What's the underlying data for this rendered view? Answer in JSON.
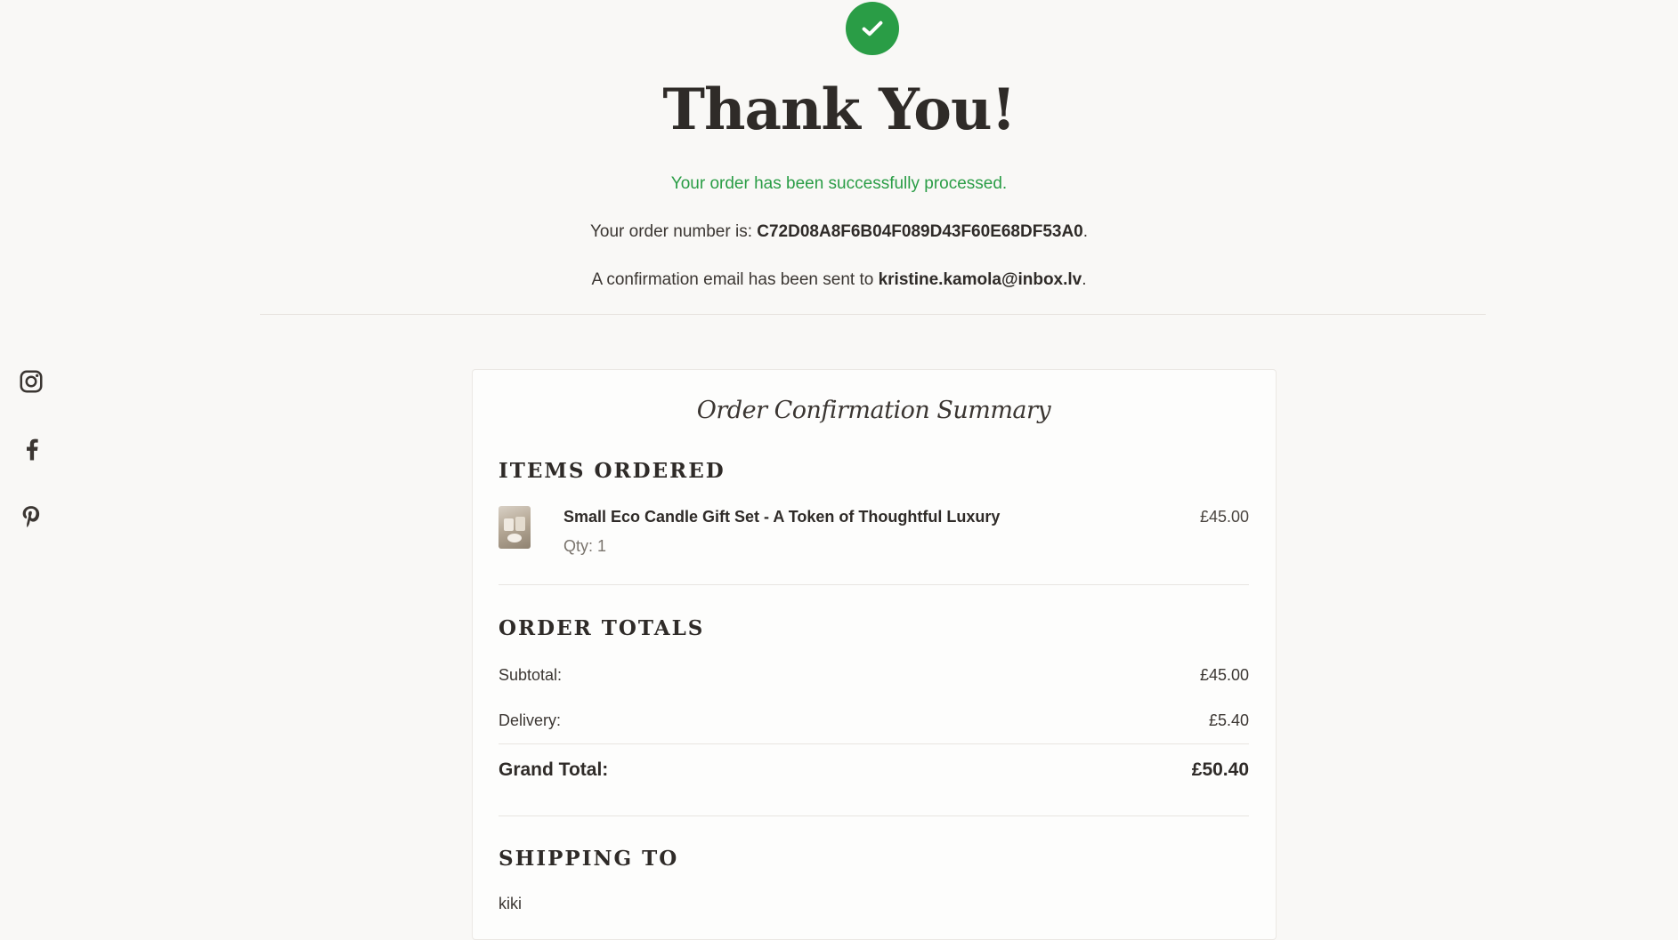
{
  "hero": {
    "title": "Thank You!",
    "success_message": "Your order has been successfully processed.",
    "order_number_prefix": "Your order number is: ",
    "order_number": "C72D08A8F6B04F089D43F60E68DF53A0",
    "order_number_suffix": ".",
    "email_prefix": "A confirmation email has been sent to ",
    "email": "kristine.kamola@inbox.lv",
    "email_suffix": "."
  },
  "social": {
    "icons": [
      "instagram-icon",
      "facebook-icon",
      "pinterest-icon"
    ]
  },
  "summary": {
    "title": "Order Confirmation Summary",
    "items_heading": "Items Ordered",
    "items": [
      {
        "name": "Small Eco Candle Gift Set - A Token of Thoughtful Luxury",
        "qty_label": "Qty: 1",
        "price": "£45.00"
      }
    ],
    "totals_heading": "Order Totals",
    "subtotal_label": "Subtotal:",
    "subtotal_value": "£45.00",
    "delivery_label": "Delivery:",
    "delivery_value": "£5.40",
    "grand_total_label": "Grand Total:",
    "grand_total_value": "£50.40",
    "shipping_heading": "Shipping To",
    "shipping_name": "kiki"
  },
  "colors": {
    "accent_green": "#2a9d46",
    "text_dark": "#2f2b28",
    "background": "#f9f8f6"
  }
}
